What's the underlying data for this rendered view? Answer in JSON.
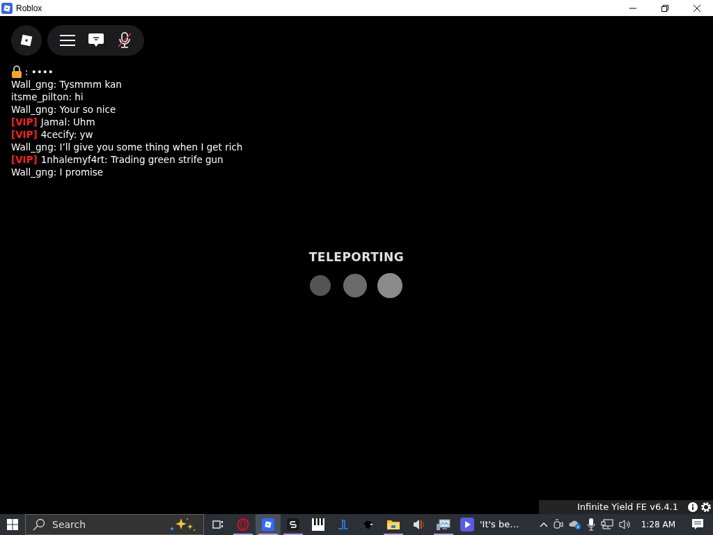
{
  "window": {
    "title": "Roblox"
  },
  "chat": {
    "locked_line": ": ••••",
    "messages": [
      {
        "text": "Wall_gng: Tysmmm kan"
      },
      {
        "text": "itsme_pilton: hi"
      },
      {
        "text": "Wall_gng: Your so nice"
      },
      {
        "tag": "[VIP]",
        "text": "Jamal: Uhm"
      },
      {
        "tag": "[VIP]",
        "text": "4cecify: yw"
      },
      {
        "text": "Wall_gng: I’ll give you some thing when I get rich"
      },
      {
        "tag": "[VIP]",
        "text": "1nhalemyf4rt: Trading green strife gun"
      },
      {
        "text": "Wall_gng: I promise"
      }
    ]
  },
  "loading": {
    "title": "TELEPORTING"
  },
  "overlay": {
    "label": "Infinite Yield FE v6.4.1"
  },
  "taskbar": {
    "search_placeholder": "Search",
    "apps": [
      {
        "kind": "taskview",
        "running": false,
        "selected": false
      },
      {
        "kind": "opera",
        "running": true,
        "selected": false
      },
      {
        "kind": "roblox",
        "running": true,
        "selected": true
      },
      {
        "kind": "sketch",
        "running": true,
        "selected": false
      },
      {
        "kind": "piano",
        "running": false,
        "selected": false
      },
      {
        "kind": "line",
        "running": false,
        "selected": false
      },
      {
        "kind": "bird",
        "running": false,
        "selected": false
      },
      {
        "kind": "folder",
        "running": true,
        "selected": false
      },
      {
        "kind": "speaker",
        "running": false,
        "selected": false
      },
      {
        "kind": "monitor",
        "running": true,
        "selected": false
      }
    ],
    "media": {
      "title": "'It's be…"
    },
    "clock": "1:28 AM"
  }
}
